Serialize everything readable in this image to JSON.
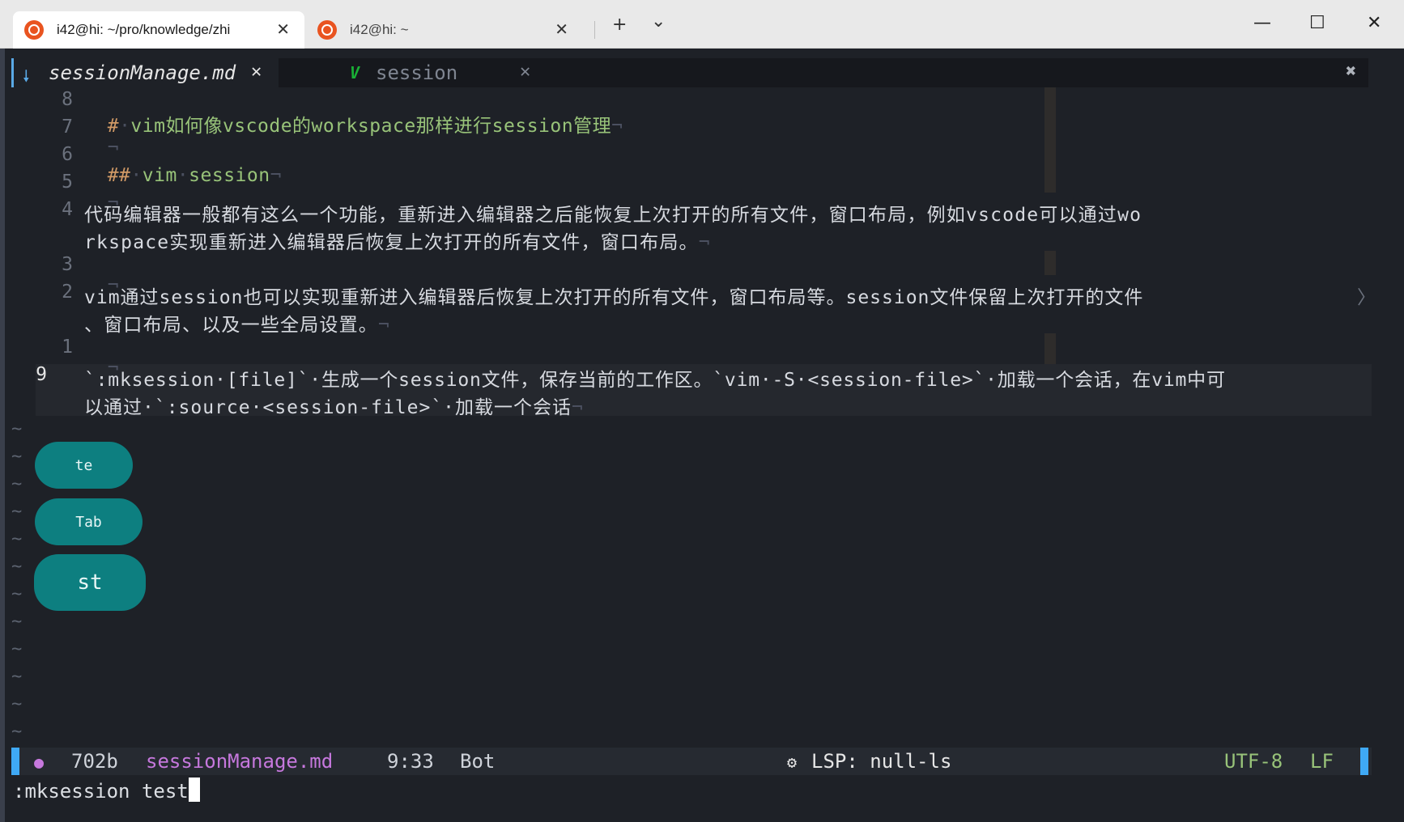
{
  "window": {
    "tabs": [
      {
        "title": "i42@hi: ~/pro/knowledge/zhi",
        "icon": "ubuntu-icon",
        "active": true
      },
      {
        "title": "i42@hi: ~",
        "icon": "ubuntu-icon",
        "active": false
      }
    ],
    "new_tab": "+",
    "dropdown": "⌄",
    "controls": {
      "minimize": "—",
      "maximize": "☐",
      "close": "✕"
    }
  },
  "bufferline": {
    "buffers": [
      {
        "name": "sessionManage.md",
        "icon": "bookmark-icon",
        "close": "✕",
        "active": true
      },
      {
        "name": "session",
        "icon": "vim-icon",
        "icon_glyph": "V",
        "close": "✕",
        "active": false
      }
    ],
    "close_all": "✖"
  },
  "editor": {
    "lines": [
      {
        "num": "8",
        "segments": [
          {
            "t": "#",
            "c": "orange"
          },
          {
            "t": "·",
            "c": "dim"
          },
          {
            "t": "vim如何像vscode的workspace那样进行session管理",
            "c": "green"
          },
          {
            "t": "¬",
            "c": "dim"
          }
        ]
      },
      {
        "num": "7",
        "segments": [
          {
            "t": "¬",
            "c": "dim"
          }
        ]
      },
      {
        "num": "6",
        "segments": [
          {
            "t": "##",
            "c": "orange"
          },
          {
            "t": "·",
            "c": "dim"
          },
          {
            "t": "vim",
            "c": "green"
          },
          {
            "t": "·",
            "c": "dim"
          },
          {
            "t": "session",
            "c": "green"
          },
          {
            "t": "¬",
            "c": "dim"
          }
        ]
      },
      {
        "num": "5",
        "segments": [
          {
            "t": "¬",
            "c": "dim"
          }
        ]
      },
      {
        "num": "4",
        "wrap": [
          "代码编辑器一般都有这么一个功能，重新进入编辑器之后能恢复上次打开的所有文件，窗口布局，例如vscode可以通过wo",
          "rkspace实现重新进入编辑器后恢复上次打开的所有文件，窗口布局。"
        ]
      },
      {
        "num": "3",
        "segments": [
          {
            "t": "¬",
            "c": "dim"
          }
        ]
      },
      {
        "num": "2",
        "wrap": [
          "vim通过session也可以实现重新进入编辑器后恢复上次打开的所有文件，窗口布局等。session文件保留上次打开的文件",
          "、窗口布局、以及一些全局设置。"
        ],
        "overflow": "〉"
      },
      {
        "num": "1",
        "segments": [
          {
            "t": "¬",
            "c": "dim"
          }
        ]
      },
      {
        "num": "9",
        "current": true,
        "wrap": [
          "`:mksession·[file]`·生成一个session文件，保存当前的工作区。`vim·-S·<session-file>`·加载一个会话，在vim中可",
          "以通过·`:source·<session-file>`·加载一个会话"
        ]
      }
    ],
    "eol": "¬",
    "tilde": "~"
  },
  "overlay_keys": [
    {
      "label": "te"
    },
    {
      "label": "Tab"
    },
    {
      "label": "st"
    }
  ],
  "statusline": {
    "mode_icon": "cat-icon",
    "size": "702b",
    "filename": "sessionManage.md",
    "position": "9:33",
    "scroll": "Bot",
    "lsp_icon": "gear-icon",
    "lsp": "LSP: null-ls",
    "encoding": "UTF-8",
    "format": "LF"
  },
  "cmdline": {
    "text": ":mksession test"
  },
  "colors": {
    "heading": "#98c379",
    "marker": "#d19a66",
    "filename": "#c678dd",
    "encoding": "#98c379",
    "accent": "#3fa9f5",
    "pill": "#0d7f80"
  }
}
